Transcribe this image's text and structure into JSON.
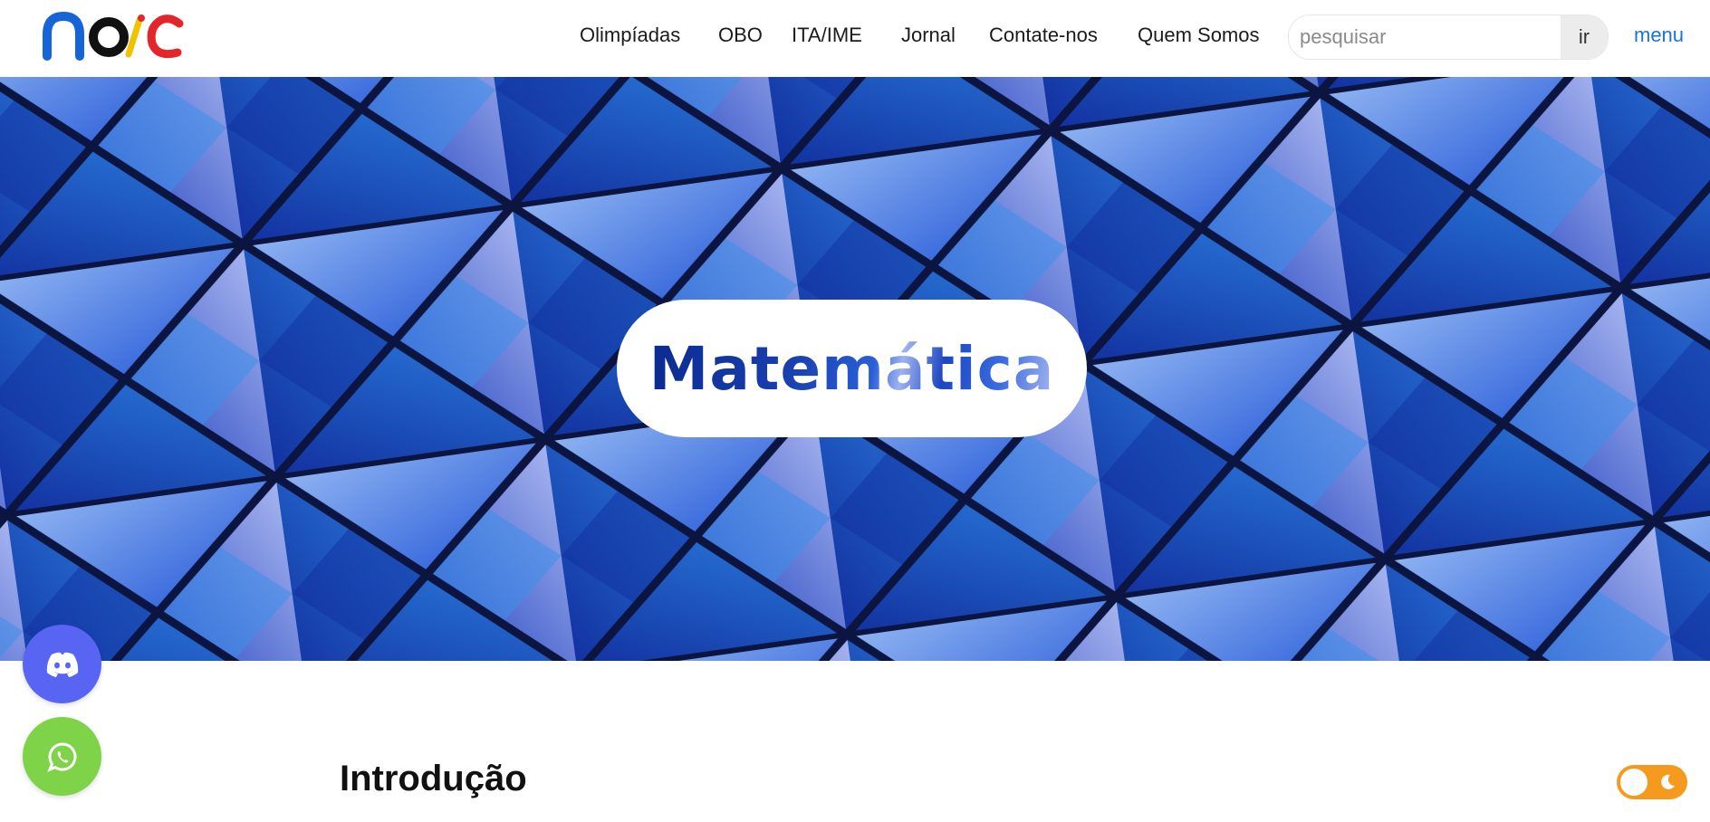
{
  "header": {
    "logo_text": "noic",
    "nav": [
      "Olimpíadas",
      "OBO",
      "ITA/IME",
      "Jornal",
      "Contate-nos",
      "Quem Somos"
    ],
    "search": {
      "placeholder": "pesquisar",
      "value": "",
      "button_label": "ir"
    },
    "menu_label": "menu"
  },
  "hero": {
    "title": "Matemática",
    "background": "blue geometric triangular architecture photo"
  },
  "content": {
    "heading": "Introdução"
  },
  "floating": {
    "discord_icon": "discord-icon",
    "whatsapp_icon": "whatsapp-icon"
  },
  "theme_toggle": {
    "state": "light",
    "icon": "moon-icon"
  },
  "colors": {
    "accent_link": "#1a73d9",
    "discord": "#5865f2",
    "whatsapp": "#7ed348",
    "toggle": "#f39a1f",
    "hero_blue": "#1d49c9"
  }
}
